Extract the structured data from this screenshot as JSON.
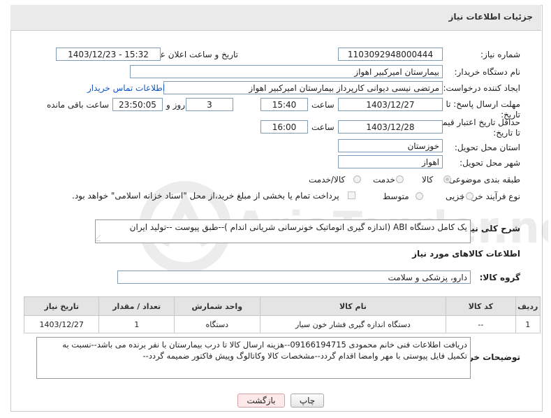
{
  "header": {
    "title": "جزئیات اطلاعات نیاز"
  },
  "fields": {
    "need_number_label": "شماره نیاز:",
    "need_number": "1103092948000444",
    "announce_label": "تاریخ و ساعت اعلان عمومی:",
    "announce_value": "1403/12/23 - 15:32",
    "buyer_label": "نام دستگاه خریدار:",
    "buyer_value": "بیمارستان امیرکبیر اهواز",
    "creator_label": "ایجاد کننده درخواست:",
    "creator_value": "مرتضی نیسی دیوانی کارپرداز بیمارستان امیرکبیر اهواز",
    "contact_link": "اطلاعات تماس خریدار",
    "deadline_label": "مهلت ارسال پاسخ: تا تاریخ:",
    "deadline_date": "1403/12/27",
    "hour_label": "ساعت",
    "deadline_time": "15:40",
    "days_value": "3",
    "days_label": "روز و",
    "remaining_time": "23:50:05",
    "remaining_label": "ساعت باقی مانده",
    "validity_label": "حداقل تاریخ اعتبار قیمت: تا تاریخ:",
    "validity_date": "1403/12/28",
    "validity_hour_label": "ساعت",
    "validity_time": "16:00",
    "province_label": "استان محل تحویل:",
    "province_value": "خوزستان",
    "city_label": "شهر محل تحویل:",
    "city_value": "اهواز",
    "category_label": "طبقه بندی موضوعی:",
    "category_options": [
      "کالا",
      "خدمت",
      "کالا/خدمت"
    ],
    "process_label": "نوع فرآیند خرید :",
    "process_options": [
      "جزیی",
      "متوسط"
    ],
    "payment_note": "پرداخت تمام یا بخشی از مبلغ خرید،از محل \"اسناد خزانه اسلامی\" خواهد بود.",
    "summary_label": "شرح کلی نیاز:",
    "summary_value": "یک کامل دستگاه ABI (اندازه گیری اتوماتیک خونرسانی شریانی اندام )--طبق پیوست --تولید ایران",
    "goods_info_title": "اطلاعات کالاهای مورد نیاز",
    "goods_group_label": "گروه کالا:",
    "goods_group_value": "دارو، پزشکی و سلامت"
  },
  "table": {
    "headers": [
      "ردیف",
      "کد کالا",
      "نام کالا",
      "واحد شمارش",
      "تعداد / مقدار",
      "تاریخ نیاز"
    ],
    "rows": [
      [
        "1",
        "--",
        "دستگاه اندازه گیری فشار خون سیار",
        "دستگاه",
        "1",
        "1403/12/27"
      ]
    ]
  },
  "buyer_notes": {
    "label": "توضیحات خریدار:",
    "line1": "دریافت اطلاعات فنی خانم محمودی 09166194715--هزینه  ارسال کالا تا درب بیمارستان با نفر برنده می باشد--نسبت به",
    "line2": "تکمیل فایل پیوستی با مهر وامضا اقدام گردد--مشخصات کالا وکاتالوگ وپیش فاکتور ضمیمه گردد--"
  },
  "buttons": {
    "print": "چاپ",
    "back": "بازگشت"
  },
  "watermark_text": "AriaTender.neT"
}
